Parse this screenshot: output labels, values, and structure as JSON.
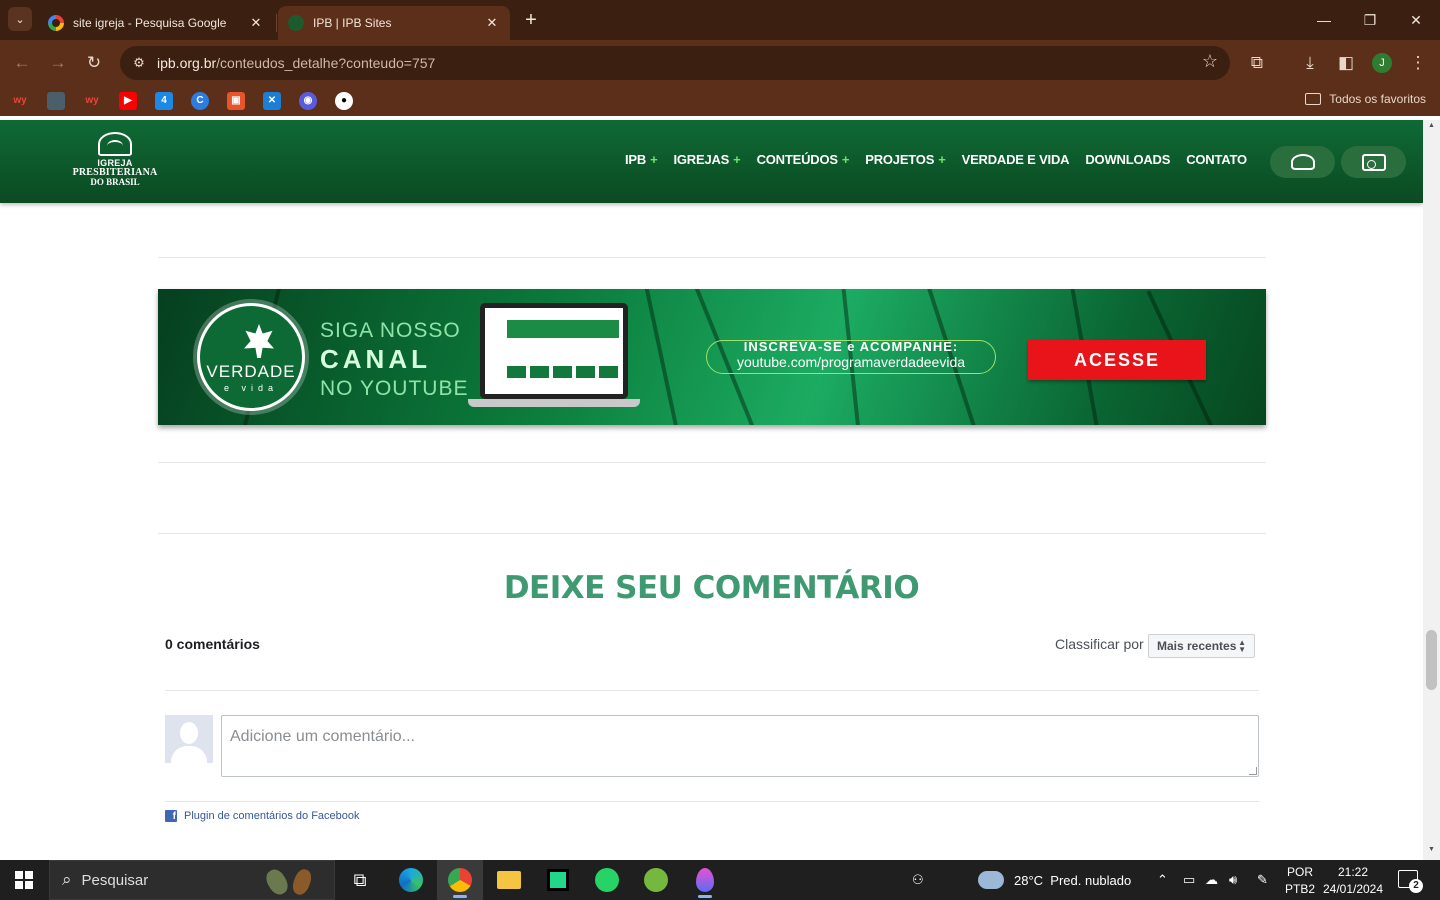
{
  "browser": {
    "tabs": [
      {
        "title": "site igreja - Pesquisa Google",
        "favicon": "google-icon"
      },
      {
        "title": "IPB | IPB Sites",
        "favicon": "ipb-icon"
      }
    ],
    "url": {
      "domain": "ipb.org.br",
      "path": "/conteudos_detalhe?conteudo=757"
    },
    "profile_initial": "J",
    "bookmarks_folder": "Todos os favoritos",
    "theme_colors": {
      "frame": "#3b1f10",
      "toolbar": "#5b2f1a"
    }
  },
  "site": {
    "logo": {
      "line1": "IGREJA",
      "line2": "PRESBITERIANA",
      "line3": "DO BRASIL"
    },
    "nav": [
      {
        "label": "IPB",
        "has_plus": true
      },
      {
        "label": "IGREJAS",
        "has_plus": true
      },
      {
        "label": "CONTEÚDOS",
        "has_plus": true
      },
      {
        "label": "PROJETOS",
        "has_plus": true
      },
      {
        "label": "VERDADE E VIDA",
        "has_plus": false
      },
      {
        "label": "DOWNLOADS",
        "has_plus": false
      },
      {
        "label": "CONTATO",
        "has_plus": false
      }
    ],
    "brand_color": "#0f6a35"
  },
  "banner": {
    "logo_text": "VERDADE",
    "logo_subtext": "e vida",
    "line1": "SIGA NOSSO",
    "line2": "CANAL",
    "line3": "NO YOUTUBE",
    "cta_title": "INSCREVA-SE e ACOMPANHE:",
    "cta_url": "youtube.com/programaverdadeevida",
    "button": "ACESSE"
  },
  "comments": {
    "title": "DEIXE SEU COMENTÁRIO",
    "count": "0 comentários",
    "sort_label": "Classificar por",
    "sort_value": "Mais recentes",
    "placeholder": "Adicione um comentário...",
    "plugin_label": "Plugin de comentários do Facebook",
    "title_color": "#3f9a72"
  },
  "taskbar": {
    "search_placeholder": "Pesquisar",
    "weather": {
      "temp": "28°C",
      "desc": "Pred. nublado"
    },
    "lang": {
      "line1": "POR",
      "line2": "PTB2"
    },
    "clock": {
      "time": "21:22",
      "date": "24/01/2024"
    },
    "notifications": "2"
  }
}
